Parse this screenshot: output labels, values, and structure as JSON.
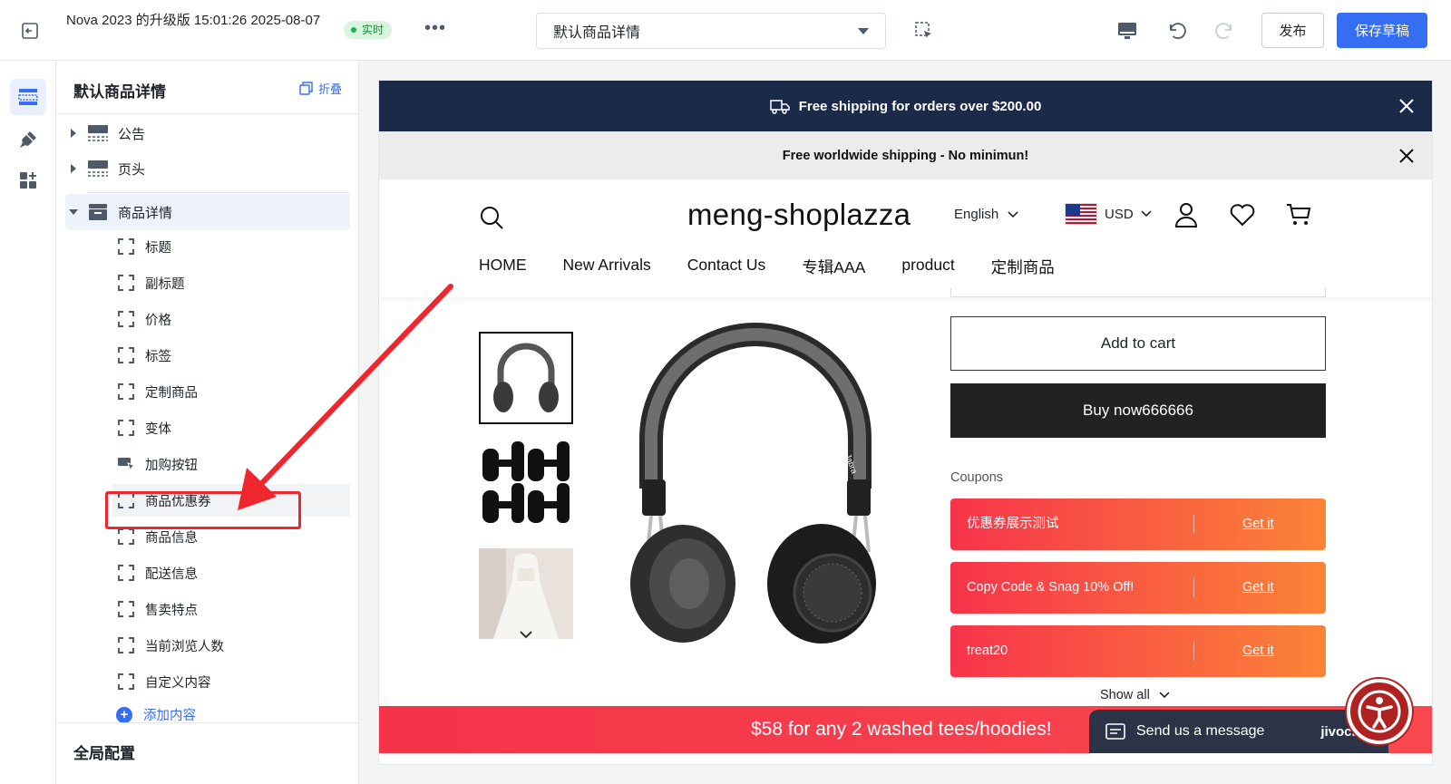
{
  "topbar": {
    "page_name": "Nova 2023 的升级版 15:01:26 2025-08-07",
    "live_badge": "实时",
    "more": "•••",
    "template": "默认商品详情",
    "publish": "发布",
    "save_draft": "保存草稿"
  },
  "panel": {
    "title": "默认商品详情",
    "collapse": "折叠",
    "sections": [
      {
        "label": "公告"
      },
      {
        "label": "页头"
      },
      {
        "label": "商品详情"
      }
    ],
    "blocks": [
      {
        "label": "标题"
      },
      {
        "label": "副标题"
      },
      {
        "label": "价格"
      },
      {
        "label": "标签"
      },
      {
        "label": "定制商品"
      },
      {
        "label": "变体"
      },
      {
        "label": "加购按钮"
      },
      {
        "label": "商品优惠券"
      },
      {
        "label": "商品信息"
      },
      {
        "label": "配送信息"
      },
      {
        "label": "售卖特点"
      },
      {
        "label": "当前浏览人数"
      },
      {
        "label": "自定义内容"
      }
    ],
    "add_content": "添加内容",
    "global_config": "全局配置"
  },
  "store": {
    "announcement_1": "Free shipping for orders over $200.00",
    "announcement_2": "Free worldwide shipping - No minimun!",
    "logo": "meng-shoplazza",
    "language": "English",
    "currency": "USD",
    "nav": [
      "HOME",
      "New Arrivals",
      "Contact Us",
      "专辑AAA",
      "product",
      "定制商品"
    ],
    "add_to_cart": "Add to cart",
    "buy_now": "Buy now666666",
    "coupons_label": "Coupons",
    "coupons": [
      {
        "title": "优惠券展示测试",
        "action": "Get it"
      },
      {
        "title": "Copy Code & Snag 10% Off!",
        "action": "Get it"
      },
      {
        "title": "treat20",
        "action": "Get it"
      }
    ],
    "show_all": "Show all",
    "promo": "$58 for any 2 washed tees/hoodies!",
    "chat_label": "Send us a message",
    "chat_brand": "jivochat",
    "headphone_brand": "Jabra"
  },
  "colors": {
    "primary": "#356df3",
    "announcement_bg": "#1c2a4a",
    "coupon_start": "#f7334b",
    "coupon_end": "#fb8437",
    "highlight": "#f0262f"
  }
}
